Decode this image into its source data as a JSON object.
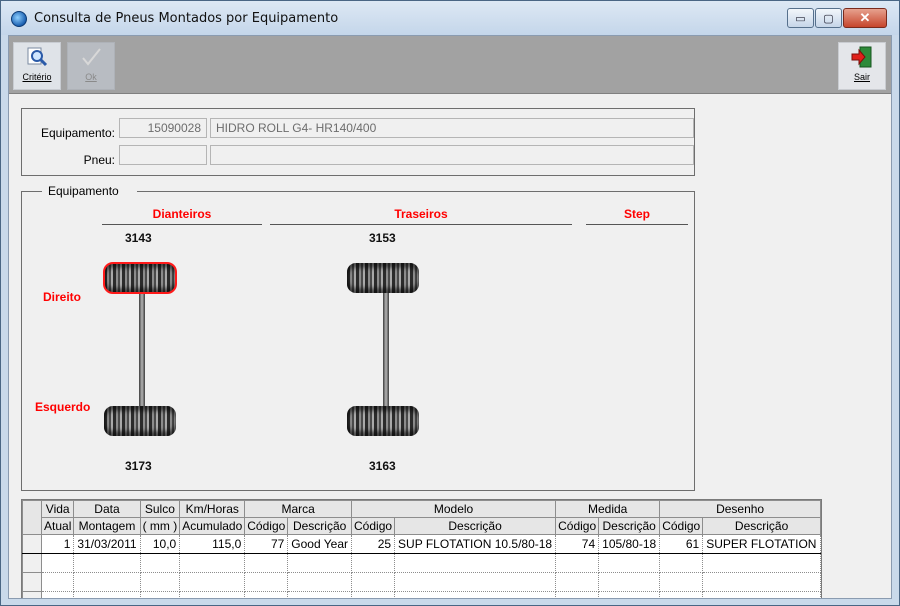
{
  "window": {
    "title": "Consulta de Pneus Montados por Equipamento",
    "controls": {
      "minimize": "▭",
      "maximize": "▢",
      "close": "✕"
    }
  },
  "toolbar": {
    "criterio_label": "Critério",
    "ok_label": "Ok",
    "sair_label": "Sair"
  },
  "form": {
    "equipamento_label": "Equipamento:",
    "equipamento_code": "15090028",
    "equipamento_desc": "HIDRO ROLL G4- HR140/400",
    "pneu_label": "Pneu:",
    "pneu_code": "",
    "pneu_desc": ""
  },
  "diagram": {
    "group_title": "Equipamento",
    "sections": {
      "front": "Dianteiros",
      "rear": "Traseiros",
      "step": "Step"
    },
    "labels": {
      "right": "Direito",
      "left": "Esquerdo"
    },
    "tires": {
      "front_right": "3143",
      "rear_right": "3153",
      "front_left": "3173",
      "rear_left": "3163"
    },
    "selected_tire": "front_right"
  },
  "grid": {
    "group_headers": [
      "Marca",
      "Modelo",
      "Medida",
      "Desenho"
    ],
    "headers": {
      "vida": [
        "Vida",
        "Atual"
      ],
      "data": [
        "Data",
        "Montagem"
      ],
      "sulco": [
        "Sulco",
        "( mm )"
      ],
      "km": [
        "Km/Horas",
        "Acumulado"
      ],
      "codigo": "Código",
      "descricao": "Descrição"
    },
    "rows": [
      {
        "vida": "1",
        "data": "31/03/2011",
        "sulco": "10,0",
        "km": "115,0",
        "marca_codigo": "77",
        "marca_desc": "Good Year",
        "modelo_codigo": "25",
        "modelo_desc": "SUP FLOTATION 10.5/80-18",
        "medida_codigo": "74",
        "medida_desc": "105/80-18",
        "desenho_codigo": "61",
        "desenho_desc": "SUPER FLOTATION"
      }
    ]
  }
}
